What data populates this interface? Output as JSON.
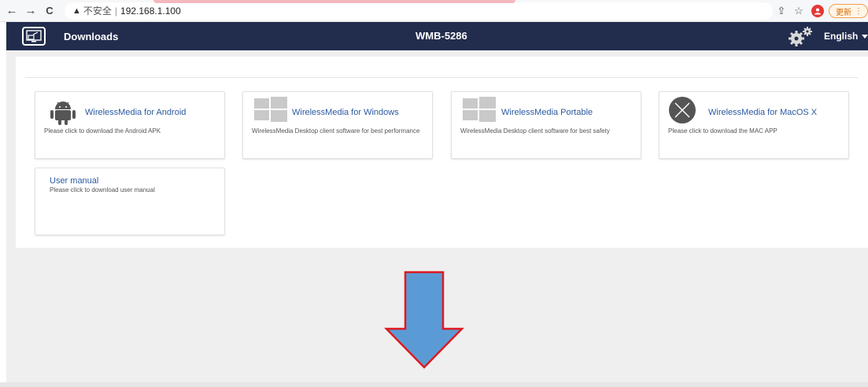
{
  "browser": {
    "back_icon": "←",
    "forward_icon": "→",
    "reload_icon": "C",
    "warning_icon": "▲",
    "security_label": "不安全",
    "separator": "|",
    "url": "192.168.1.100",
    "share_icon": "⇪",
    "star_icon": "☆",
    "update_label": "更新",
    "menu_icon": "⋮"
  },
  "header": {
    "title": "Downloads",
    "device_name": "WMB-5286",
    "language": "English"
  },
  "cards": [
    {
      "title": "WirelessMedia for Android",
      "desc": "Please click to download the Android APK",
      "icon": "android-icon"
    },
    {
      "title": "WirelessMedia for Windows",
      "desc": "WirelessMedia Desktop client software for best performance",
      "icon": "windows-icon"
    },
    {
      "title": "WirelessMedia Portable",
      "desc": "WirelessMedia Desktop client software for best safety",
      "icon": "windows-icon"
    },
    {
      "title": "WirelessMedia for MacOS X",
      "desc": "Please click to download the MAC APP",
      "icon": "macos-x-icon"
    },
    {
      "title": "User manual",
      "desc": "Please click to download user manual",
      "icon": ""
    }
  ],
  "colors": {
    "header_bg": "#222c4d",
    "link": "#2c5aa0",
    "arrow_fill": "#5b9bd5",
    "arrow_stroke": "#e0191f"
  }
}
